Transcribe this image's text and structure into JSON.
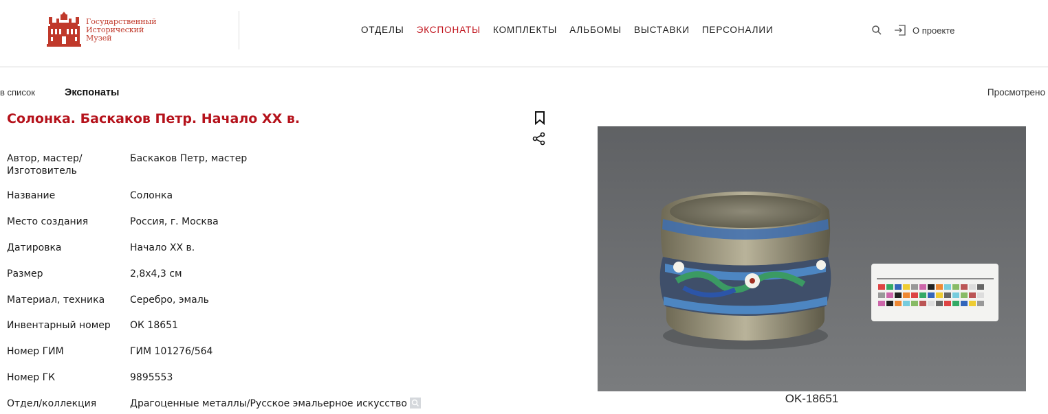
{
  "header": {
    "logo_lines": [
      "Государственный",
      "Исторический",
      "Музей"
    ],
    "nav": [
      {
        "label": "ОТДЕЛЫ",
        "active": false
      },
      {
        "label": "ЭКСПОНАТЫ",
        "active": true
      },
      {
        "label": "КОМПЛЕКТЫ",
        "active": false
      },
      {
        "label": "АЛЬБОМЫ",
        "active": false
      },
      {
        "label": "ВЫСТАВКИ",
        "active": false
      },
      {
        "label": "ПЕРСОНАЛИИ",
        "active": false
      }
    ],
    "search_icon": "search-icon",
    "login_icon": "login-icon",
    "about_label": "О проекте",
    "accent_color": "#c0121b"
  },
  "breadcrumbs": {
    "back_label": "в список",
    "current": "Экспонаты",
    "viewed": "Просмотрено"
  },
  "item": {
    "title": "Солонка. Баскаков Петр. Начало XX в.",
    "properties": [
      {
        "key": "Автор, мастер/ Изготовитель",
        "value": "Баскаков Петр, мастер"
      },
      {
        "key": "Название",
        "value": "Солонка"
      },
      {
        "key": "Место создания",
        "value": "Россия, г. Москва"
      },
      {
        "key": "Датировка",
        "value": "Начало XX в."
      },
      {
        "key": "Размер",
        "value": "2,8x4,3 см"
      },
      {
        "key": "Материал, техника",
        "value": "Серебро, эмаль"
      },
      {
        "key": "Инвентарный номер",
        "value": "ОК 18651"
      },
      {
        "key": "Номер ГИМ",
        "value": "ГИМ 101276/564"
      },
      {
        "key": "Номер ГК",
        "value": "9895553"
      },
      {
        "key": "Отдел/коллекция",
        "value": "Драгоценные металлы/Русское эмальерное искусство"
      }
    ],
    "image_caption": "OK-18651"
  }
}
